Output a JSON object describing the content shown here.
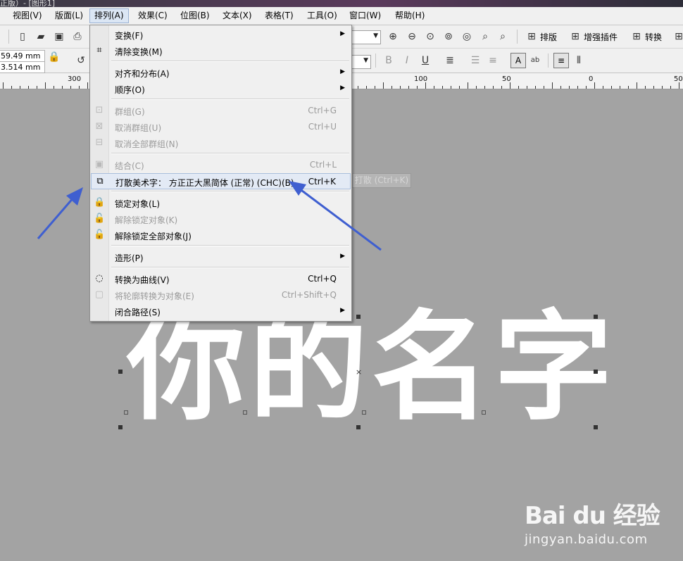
{
  "window": {
    "title_fragment": "正版）- [图形1]"
  },
  "menubar": [
    {
      "label": "视图(V)"
    },
    {
      "label": "版面(L)"
    },
    {
      "label": "排列(A)"
    },
    {
      "label": "效果(C)"
    },
    {
      "label": "位图(B)"
    },
    {
      "label": "文本(X)"
    },
    {
      "label": "表格(T)"
    },
    {
      "label": "工具(O)"
    },
    {
      "label": "窗口(W)"
    },
    {
      "label": "帮助(H)"
    }
  ],
  "toolbar": {
    "plugin_buttons": [
      {
        "label": "排版"
      },
      {
        "label": "增强插件"
      },
      {
        "label": "转换"
      }
    ]
  },
  "property_bar": {
    "width_value": "59.49 mm",
    "height_value": "3.514 mm"
  },
  "ruler": {
    "labels": [
      "300",
      "100",
      "50",
      "0",
      "50"
    ]
  },
  "arrange_menu": {
    "items": [
      {
        "label": "变换(F)",
        "shortcut": "",
        "submenu": true,
        "disabled": false,
        "icon": ""
      },
      {
        "label": "清除变换(M)",
        "shortcut": "",
        "submenu": false,
        "disabled": false,
        "icon": "clear-transform-icon"
      },
      {
        "label": "对齐和分布(A)",
        "shortcut": "",
        "submenu": true,
        "disabled": false,
        "icon": ""
      },
      {
        "label": "顺序(O)",
        "shortcut": "",
        "submenu": true,
        "disabled": false,
        "icon": ""
      },
      {
        "label": "群组(G)",
        "shortcut": "Ctrl+G",
        "submenu": false,
        "disabled": true,
        "icon": "group-icon"
      },
      {
        "label": "取消群组(U)",
        "shortcut": "Ctrl+U",
        "submenu": false,
        "disabled": true,
        "icon": "ungroup-icon"
      },
      {
        "label": "取消全部群组(N)",
        "shortcut": "",
        "submenu": false,
        "disabled": true,
        "icon": "ungroup-all-icon"
      },
      {
        "label": "结合(C)",
        "shortcut": "Ctrl+L",
        "submenu": false,
        "disabled": true,
        "icon": "combine-icon"
      },
      {
        "label": "打散美术字： 方正正大黑简体 (正常) (CHC)(B)",
        "shortcut": "Ctrl+K",
        "submenu": false,
        "disabled": false,
        "icon": "break-apart-icon"
      },
      {
        "label": "锁定对象(L)",
        "shortcut": "",
        "submenu": false,
        "disabled": false,
        "icon": "lock-icon"
      },
      {
        "label": "解除锁定对象(K)",
        "shortcut": "",
        "submenu": false,
        "disabled": true,
        "icon": "unlock-icon"
      },
      {
        "label": "解除锁定全部对象(J)",
        "shortcut": "",
        "submenu": false,
        "disabled": false,
        "icon": "unlock-all-icon"
      },
      {
        "label": "造形(P)",
        "shortcut": "",
        "submenu": true,
        "disabled": false,
        "icon": ""
      },
      {
        "label": "转换为曲线(V)",
        "shortcut": "Ctrl+Q",
        "submenu": false,
        "disabled": false,
        "icon": "convert-to-curves-icon"
      },
      {
        "label": "将轮廓转换为对象(E)",
        "shortcut": "Ctrl+Shift+Q",
        "submenu": false,
        "disabled": true,
        "icon": "outline-to-object-icon"
      },
      {
        "label": "闭合路径(S)",
        "shortcut": "",
        "submenu": true,
        "disabled": false,
        "icon": ""
      }
    ]
  },
  "canvas": {
    "artistic_text": "你的名字",
    "tooltip_ghost": "打散 (Ctrl+K)"
  },
  "watermark": {
    "logo": "Bai du 经验",
    "url": "jingyan.baidu.com"
  },
  "colors": {
    "canvas": "#a3a3a3",
    "menu_bg": "#f0f0f0",
    "highlight": "#e3eaf5",
    "arrow": "#3f5fd0",
    "text": "#ffffff"
  }
}
